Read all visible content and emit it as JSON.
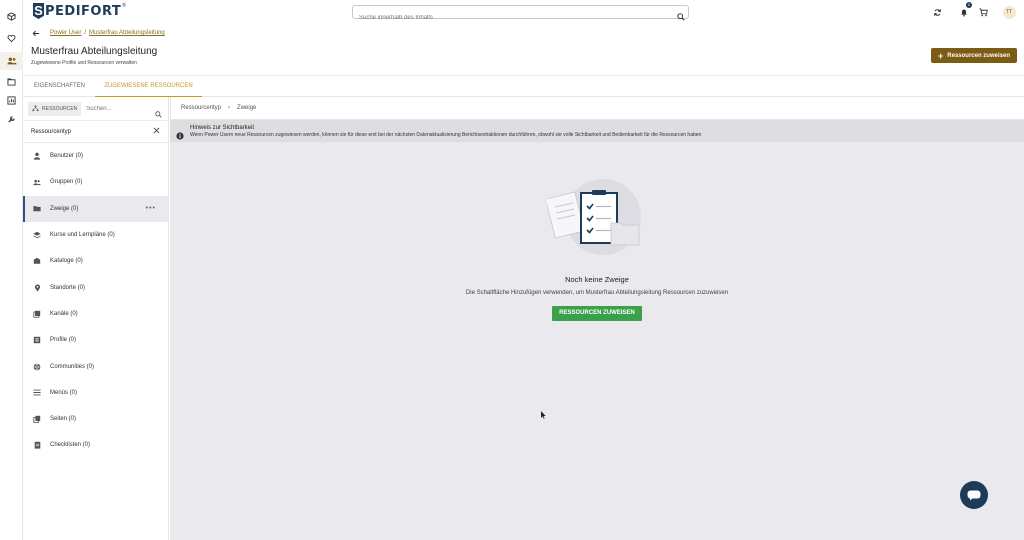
{
  "brand": {
    "logo_letter": "S",
    "logo_text": "PEDIFORT",
    "logo_mark": "®"
  },
  "search": {
    "placeholder": "Suche innerhalb des Inhalts"
  },
  "topbar": {
    "notifications_count": "0",
    "avatar_initials": "TT"
  },
  "breadcrumb": {
    "items": [
      "Power User",
      "Musterfrau Abteilungsleitung"
    ],
    "separator": "/"
  },
  "page": {
    "title": "Musterfrau Abteilungsleitung",
    "subtitle": "Zugewiesene Profile und Ressourcen verwalten",
    "assign_button": "Ressourcen zuweisen"
  },
  "tabs": [
    {
      "label": "EIGENSCHAFTEN",
      "active": false
    },
    {
      "label": "ZUGEWIESENE RESSOURCEN",
      "active": true
    }
  ],
  "left_panel": {
    "chip_label": "RESSOURCEN",
    "search_placeholder": "Suchen...",
    "header": "Ressourcentyp",
    "items": [
      {
        "label": "Benutzer (0)",
        "icon": "person-icon"
      },
      {
        "label": "Gruppen (0)",
        "icon": "group-icon"
      },
      {
        "label": "Zweige (0)",
        "icon": "folder-icon",
        "active": true
      },
      {
        "label": "Kurse und Lernpläne (0)",
        "icon": "layers-icon"
      },
      {
        "label": "Kataloge (0)",
        "icon": "catalog-icon"
      },
      {
        "label": "Standorte (0)",
        "icon": "location-pin-icon"
      },
      {
        "label": "Kanäle (0)",
        "icon": "channel-icon"
      },
      {
        "label": "Profile (0)",
        "icon": "profile-card-icon"
      },
      {
        "label": "Communities (0)",
        "icon": "globe-icon"
      },
      {
        "label": "Menüs (0)",
        "icon": "menu-icon"
      },
      {
        "label": "Seiten (0)",
        "icon": "pages-icon"
      },
      {
        "label": "Checklisten (0)",
        "icon": "checklist-icon"
      }
    ]
  },
  "main": {
    "breadcrumb": [
      "Ressourcentyp",
      "Zweige"
    ],
    "breadcrumb_separator": "›",
    "notice_title": "Hinweis zur Sichtbarkeit",
    "notice_text": "Wenn Power Usern neue Ressourcen zugewiesen werden, können sie für diese erst bei der nächsten Datenaktualisierung Berichtsextraktionen durchführen, obwohl sie volle Sichtbarkeit und Bedienbarkeit für die Ressourcen haben",
    "empty_title": "Noch keine Zweige",
    "empty_desc": "Die Schaltfläche Hinzufügen verwenden, um Musterfrau Abteilungsleitung Ressourcen zuzuweisen",
    "empty_button": "RESSOURCEN ZUWEISEN"
  },
  "colors": {
    "brand_navy": "#1d3c5a",
    "accent_gold": "#c99a22",
    "button_brown": "#7a5c14",
    "success_green": "#3aa04a"
  }
}
